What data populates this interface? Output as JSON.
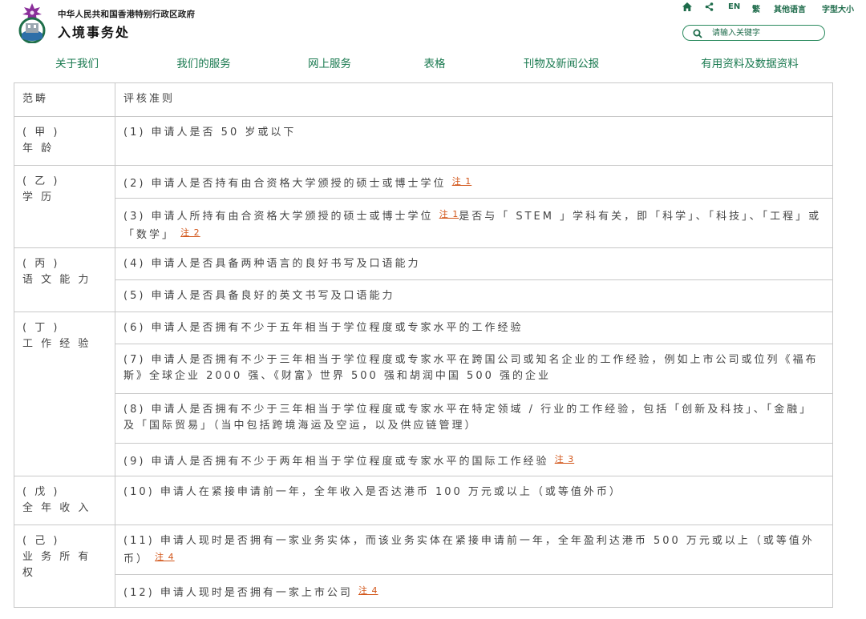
{
  "header": {
    "org_line": "中华人民共和国香港特别行政区政府",
    "org_name": "入境事务处"
  },
  "utility": {
    "lang_en": "EN",
    "lang_trad": "繁",
    "other_lang": "其他语言",
    "font_size": "字型大小"
  },
  "search": {
    "placeholder": "请输入关键字"
  },
  "nav": [
    "关于我们",
    "我们的服务",
    "网上服务",
    "表格",
    "刊物及新闻公报",
    "有用资料及数据资料"
  ],
  "table": {
    "headers": [
      "范畴",
      "评核准则"
    ],
    "notes": {
      "n1": "注 1",
      "n2": "注 2",
      "n3": "注 3",
      "n4": "注 4"
    },
    "categories": {
      "a": [
        "( 甲 )",
        "年 龄"
      ],
      "b": [
        "( 乙 )",
        "学 历"
      ],
      "c": [
        "( 丙 )",
        "语 文 能 力"
      ],
      "d": [
        "( 丁 )",
        "工 作 经 验"
      ],
      "e": [
        "( 戊 )",
        "全 年 收 入"
      ],
      "f": [
        "( 己 )",
        "业 务 所 有 权"
      ]
    },
    "criteria": {
      "c1": "(1) 申请人是否 50 岁或以下",
      "c2": "(2) 申请人是否持有由合资格大学颁授的硕士或博士学位",
      "c3_a": "(3) 申请人所持有由合资格大学颁授的硕士或博士学位",
      "c3_b": "是否与「 STEM 」学科有关，即「科学」、「科技」、「工程」或「数学」",
      "c4": "(4) 申请人是否具备两种语言的良好书写及口语能力",
      "c5": "(5) 申请人是否具备良好的英文书写及口语能力",
      "c6": "(6) 申请人是否拥有不少于五年相当于学位程度或专家水平的工作经验",
      "c7": "(7) 申请人是否拥有不少于三年相当于学位程度或专家水平在跨国公司或知名企业的工作经验，例如上市公司或位列《福布斯》全球企业 2000 强、《财富》世界 500 强和胡润中国 500 强的企业",
      "c8": "(8) 申请人是否拥有不少于三年相当于学位程度或专家水平在特定领域 / 行业的工作经验，包括「创新及科技」、「金融」及「国际贸易」（当中包括跨境海运及空运，以及供应链管理）",
      "c9": "(9) 申请人是否拥有不少于两年相当于学位程度或专家水平的国际工作经验",
      "c10": "(10) 申请人在紧接申请前一年，全年收入是否达港币 100 万元或以上（或等值外币）",
      "c11": "(11) 申请人现时是否拥有一家业务实体，而该业务实体在紧接申请前一年，全年盈利达港币 500 万元或以上（或等值外币）",
      "c12": "(12) 申请人现时是否拥有一家上市公司"
    }
  },
  "colors": {
    "brand_green": "#1a7a50",
    "note_orange": "#d2561a",
    "border": "#c8c8c8"
  }
}
